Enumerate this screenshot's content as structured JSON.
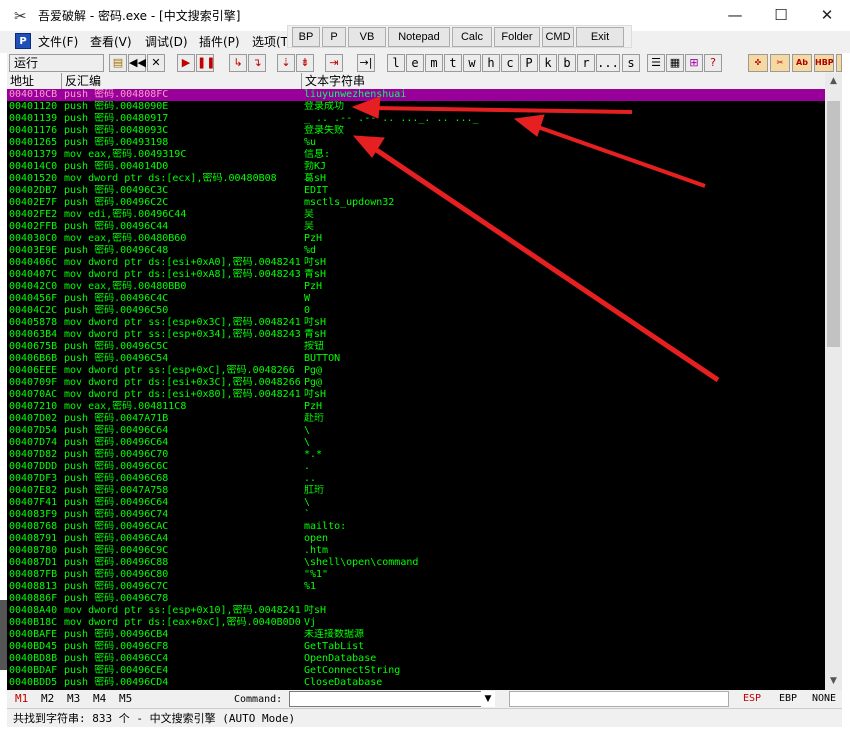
{
  "window": {
    "title": "吾爱破解 - 密码.exe - [中文搜索引擎]",
    "minimize": "—",
    "maximize": "☐",
    "close": "✕"
  },
  "menu": {
    "items": [
      "文件(F)",
      "查看(V)",
      "调试(D)",
      "插件(P)",
      "选项(T"
    ]
  },
  "plugin_toolbar": {
    "buttons": [
      "BP",
      "P",
      "VB",
      "Notepad",
      "Calc",
      "Folder",
      "CMD",
      "Exit"
    ]
  },
  "mdi_controls": [
    "—",
    "⧉",
    "✕"
  ],
  "toolbar": {
    "state": "运行",
    "letters": [
      "l",
      "e",
      "m",
      "t",
      "w",
      "h",
      "c",
      "P",
      "k",
      "b",
      "r",
      "...",
      "s"
    ],
    "icons_right": [
      "tools-icon",
      "scissors-icon",
      "abc-icon",
      "hbp-icon",
      "mbp-icon",
      "options-icon"
    ]
  },
  "columns": {
    "address": "地址",
    "disasm": "反汇编",
    "text": "文本字符串"
  },
  "rows": [
    {
      "addr": "004010CB",
      "disasm": "push 密码.004808FC",
      "text": "liuyunwezhenshuai",
      "selected": true
    },
    {
      "addr": "00401120",
      "disasm": "push 密码.0048090E",
      "text": "登录成功"
    },
    {
      "addr": "00401139",
      "disasm": "push 密码.00480917",
      "text": "_ .. .-- .-- .. ..._. .. ..._"
    },
    {
      "addr": "00401176",
      "disasm": "push 密码.0048093C",
      "text": "登录失败"
    },
    {
      "addr": "00401265",
      "disasm": "push 密码.00493198",
      "text": "%u"
    },
    {
      "addr": "00401379",
      "disasm": "mov eax,密码.0049319C",
      "text": "信息:"
    },
    {
      "addr": "004014C0",
      "disasm": "push 密码.004014D0",
      "text": "勃KJ"
    },
    {
      "addr": "00401520",
      "disasm": "mov dword ptr ds:[ecx],密码.00480B08",
      "text": "葛sH"
    },
    {
      "addr": "00402DB7",
      "disasm": "push 密码.00496C3C",
      "text": "EDIT"
    },
    {
      "addr": "00402E7F",
      "disasm": "push 密码.00496C2C",
      "text": "msctls_updown32"
    },
    {
      "addr": "00402FE2",
      "disasm": "mov edi,密码.00496C44",
      "text": "吴"
    },
    {
      "addr": "00402FFB",
      "disasm": "push 密码.00496C44",
      "text": "吴"
    },
    {
      "addr": "004030C0",
      "disasm": "mov eax,密码.00480B60",
      "text": "PzH"
    },
    {
      "addr": "00403E9E",
      "disasm": "push 密码.00496C48",
      "text": "%d"
    },
    {
      "addr": "0040406C",
      "disasm": "mov dword ptr ds:[esi+0xA0],密码.0048241",
      "text": "吋sH"
    },
    {
      "addr": "0040407C",
      "disasm": "mov dword ptr ds:[esi+0xA8],密码.0048243",
      "text": "青sH"
    },
    {
      "addr": "004042C0",
      "disasm": "mov eax,密码.00480BB0",
      "text": "PzH"
    },
    {
      "addr": "0040456F",
      "disasm": "push 密码.00496C4C",
      "text": "W"
    },
    {
      "addr": "00404C2C",
      "disasm": "push 密码.00496C50",
      "text": "0"
    },
    {
      "addr": "00405878",
      "disasm": "mov dword ptr ss:[esp+0x3C],密码.0048241",
      "text": "吋sH"
    },
    {
      "addr": "004063B4",
      "disasm": "mov dword ptr ss:[esp+0x34],密码.0048243",
      "text": "青sH"
    },
    {
      "addr": "0040675B",
      "disasm": "push 密码.00496C5C",
      "text": "按钮"
    },
    {
      "addr": "00406B6B",
      "disasm": "push 密码.00496C54",
      "text": "BUTTON"
    },
    {
      "addr": "00406EEE",
      "disasm": "mov dword ptr ss:[esp+0xC],密码.0048266",
      "text": "Pg@"
    },
    {
      "addr": "0040709F",
      "disasm": "mov dword ptr ds:[esi+0x3C],密码.0048266",
      "text": "Pg@"
    },
    {
      "addr": "004070AC",
      "disasm": "mov dword ptr ds:[esi+0x80],密码.0048241",
      "text": "吋sH"
    },
    {
      "addr": "00407210",
      "disasm": "mov eax,密码.004811C8",
      "text": "PzH"
    },
    {
      "addr": "00407D02",
      "disasm": "push 密码.0047A71B",
      "text": "赴珩"
    },
    {
      "addr": "00407D54",
      "disasm": "push 密码.00496C64",
      "text": "\\"
    },
    {
      "addr": "00407D74",
      "disasm": "push 密码.00496C64",
      "text": "\\"
    },
    {
      "addr": "00407D82",
      "disasm": "push 密码.00496C70",
      "text": "*.*"
    },
    {
      "addr": "00407DDD",
      "disasm": "push 密码.00496C6C",
      "text": "."
    },
    {
      "addr": "00407DF3",
      "disasm": "push 密码.00496C68",
      "text": ".."
    },
    {
      "addr": "00407E82",
      "disasm": "push 密码.0047A758",
      "text": "肛珩"
    },
    {
      "addr": "00407F41",
      "disasm": "push 密码.00496C64",
      "text": "\\"
    },
    {
      "addr": "004083F9",
      "disasm": "push 密码.00496C74",
      "text": "`"
    },
    {
      "addr": "00408768",
      "disasm": "push 密码.00496CAC",
      "text": "mailto:"
    },
    {
      "addr": "00408791",
      "disasm": "push 密码.00496CA4",
      "text": "open"
    },
    {
      "addr": "00408780",
      "disasm": "push 密码.00496C9C",
      "text": ".htm"
    },
    {
      "addr": "004087D1",
      "disasm": "push 密码.00496C88",
      "text": "\\shell\\open\\command"
    },
    {
      "addr": "004087FB",
      "disasm": "push 密码.00496C80",
      "text": "\"%1\""
    },
    {
      "addr": "00408813",
      "disasm": "push 密码.00496C7C",
      "text": "%1"
    },
    {
      "addr": "0040886F",
      "disasm": "push 密码.00496C78",
      "text": " "
    },
    {
      "addr": "00408A40",
      "disasm": "mov dword ptr ss:[esp+0x10],密码.0048241",
      "text": "吋sH"
    },
    {
      "addr": "0040B18C",
      "disasm": "mov dword ptr ds:[eax+0xC],密码.0040B0D0",
      "text": "Vj"
    },
    {
      "addr": "0040BAFE",
      "disasm": "push 密码.00496CB4",
      "text": "未连接数据源"
    },
    {
      "addr": "0040BD45",
      "disasm": "push 密码.00496CF8",
      "text": "GetTabList"
    },
    {
      "addr": "0040BD8B",
      "disasm": "push 密码.00496CC4",
      "text": "OpenDatabase"
    },
    {
      "addr": "0040BDAF",
      "disasm": "push 密码.00496CE4",
      "text": "GetConnectString"
    },
    {
      "addr": "0040BDD5",
      "disasm": "push 密码.00496CD4",
      "text": "CloseDatabase"
    }
  ],
  "command_bar": {
    "tabs": [
      "M1",
      "M2",
      "M3",
      "M4",
      "M5"
    ],
    "label": "Command:",
    "registers": [
      "ESP",
      "EBP",
      "NONE"
    ],
    "active_color": "#c00000"
  },
  "status": {
    "text": "共找到字符串: 833 个  -  中文搜索引擎 (AUTO Mode)"
  },
  "colors": {
    "background": "#000000",
    "text": "#00ff00",
    "selection": "#990099",
    "arrow": "#ee2222"
  }
}
